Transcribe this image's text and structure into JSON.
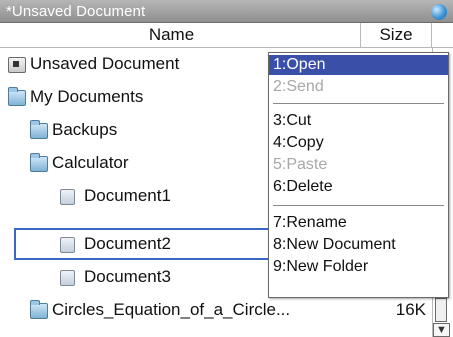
{
  "window": {
    "title": "*Unsaved Document",
    "status_icon": "battery-icon"
  },
  "columns": {
    "name": "Name",
    "size": "Size"
  },
  "files": [
    {
      "label": "Unsaved Document",
      "icon": "unsaved-document-icon",
      "size": ""
    },
    {
      "label": "My Documents",
      "icon": "folder-open-icon",
      "size": ""
    },
    {
      "label": "Backups",
      "icon": "folder-icon",
      "size": ""
    },
    {
      "label": "Calculator",
      "icon": "folder-open-icon",
      "size": ""
    },
    {
      "label": "Document1",
      "icon": "document-icon",
      "size": ""
    },
    {
      "label": "Document2",
      "icon": "document-icon",
      "size": ""
    },
    {
      "label": "Document3",
      "icon": "document-icon",
      "size": ""
    },
    {
      "label": "Circles_Equation_of_a_Circle...",
      "icon": "folder-icon",
      "size": "16K"
    }
  ],
  "context_menu": {
    "items": [
      {
        "label": "1:Open",
        "state": "highlighted"
      },
      {
        "label": "2:Send",
        "state": "disabled"
      },
      {
        "label": "3:Cut",
        "state": "enabled"
      },
      {
        "label": "4:Copy",
        "state": "enabled"
      },
      {
        "label": "5:Paste",
        "state": "disabled"
      },
      {
        "label": "6:Delete",
        "state": "enabled"
      },
      {
        "label": "7:Rename",
        "state": "enabled"
      },
      {
        "label": "8:New Document",
        "state": "enabled"
      },
      {
        "label": "9:New Folder",
        "state": "enabled"
      }
    ]
  },
  "colors": {
    "selection_outline": "#3a66c4",
    "menu_highlight": "#3a4fa8",
    "titlebar": "#a0a0a0"
  }
}
